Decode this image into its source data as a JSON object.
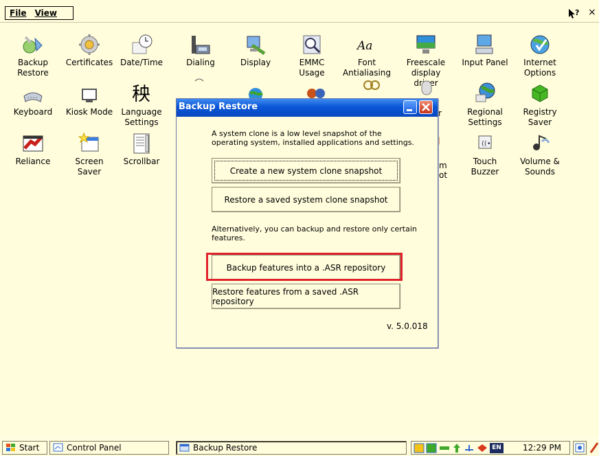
{
  "menubar": {
    "file": "File",
    "view": "View",
    "help_icon": "help-icon",
    "close": "×"
  },
  "icons": [
    {
      "label": "Backup\nRestore",
      "icon": "backup-restore-icon"
    },
    {
      "label": "Certificates",
      "icon": "certificates-icon"
    },
    {
      "label": "Date/Time",
      "icon": "date-time-icon"
    },
    {
      "label": "Dialing",
      "icon": "dialing-icon"
    },
    {
      "label": "Display",
      "icon": "display-icon"
    },
    {
      "label": "EMMC Usage",
      "icon": "emmc-usage-icon"
    },
    {
      "label": "Font\nAntialiasing",
      "icon": "font-antialiasing-icon"
    },
    {
      "label": "Freescale\ndisplay driver",
      "icon": "freescale-display-driver-icon"
    },
    {
      "label": "Input Panel",
      "icon": "input-panel-icon"
    },
    {
      "label": "Internet\nOptions",
      "icon": "internet-options-icon"
    },
    {
      "label": "Keyboard",
      "icon": "keyboard-icon"
    },
    {
      "label": "Kiosk Mode",
      "icon": "kiosk-mode-icon"
    },
    {
      "label": "Language\nSettings",
      "icon": "language-settings-icon"
    },
    {
      "label": "Regional\nSettings",
      "icon": "regional-settings-icon"
    },
    {
      "label": "Registry\nSaver",
      "icon": "registry-saver-icon"
    },
    {
      "label": "Reliance",
      "icon": "reliance-icon"
    },
    {
      "label": "Screen\nSaver",
      "icon": "screen-saver-icon"
    },
    {
      "label": "Scrollbar",
      "icon": "scrollbar-icon"
    },
    {
      "label": "Touch\nBuzzer",
      "icon": "touch-buzzer-icon"
    },
    {
      "label": "Volume &\nSounds",
      "icon": "volume-sounds-icon"
    }
  ],
  "partial_labels": {
    "row2_col8": "r",
    "row3_col8a": "m",
    "row3_col8b": "ot"
  },
  "dialog": {
    "title": "Backup Restore",
    "intro": "A system clone is a low level snapshot of the operating system, installed applications and settings.",
    "create_snapshot": "Create a new system clone snapshot",
    "restore_snapshot": "Restore a saved system clone snapshot",
    "alternative": "Alternatively, you can backup and restore only certain features.",
    "backup_features": "Backup features into a .ASR repository",
    "restore_features": "Restore features from a saved .ASR repository",
    "version": "v. 5.0.018"
  },
  "taskbar": {
    "start": "Start",
    "control_panel": "Control Panel",
    "backup_restore": "Backup Restore",
    "tray_lang": "EN",
    "clock": "12:29 PM"
  },
  "colors": {
    "background": "#fffddc",
    "title_bar": "#0a56d6",
    "highlight": "#e0232a"
  }
}
